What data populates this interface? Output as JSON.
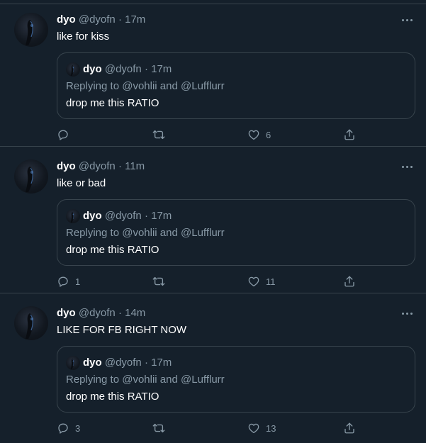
{
  "tweets": [
    {
      "name": "dyo",
      "handle": "@dyofn",
      "sep": "·",
      "time": "11m",
      "text": "like or bad",
      "quote": {
        "name": "dyo",
        "handle": "@dyofn",
        "sep": "·",
        "time": "17m",
        "replying_prefix": "Replying to ",
        "mention1": "@vohlii",
        "and": " and ",
        "mention2": "@Lufflurr",
        "text": "drop me this RATIO"
      },
      "replies": "1",
      "retweets": "",
      "likes": "11"
    },
    {
      "name": "dyo",
      "handle": "@dyofn",
      "sep": "·",
      "time": "14m",
      "text": "LIKE FOR FB RIGHT NOW",
      "quote": {
        "name": "dyo",
        "handle": "@dyofn",
        "sep": "·",
        "time": "17m",
        "replying_prefix": "Replying to ",
        "mention1": "@vohlii",
        "and": " and ",
        "mention2": "@Lufflurr",
        "text": "drop me this RATIO"
      },
      "replies": "3",
      "retweets": "",
      "likes": "13"
    },
    {
      "name": "dyo",
      "handle": "@dyofn",
      "sep": "·",
      "time": "17m",
      "text": "like for kiss",
      "quote": {
        "name": "dyo",
        "handle": "@dyofn",
        "sep": "·",
        "time": "17m",
        "replying_prefix": "Replying to ",
        "mention1": "@vohlii",
        "and": " and ",
        "mention2": "@Lufflurr",
        "text": "drop me this RATIO"
      },
      "replies": "",
      "retweets": "",
      "likes": "6"
    }
  ],
  "icons": {
    "reply": "reply-icon",
    "retweet": "retweet-icon",
    "like": "heart-icon",
    "share": "share-icon",
    "more": "more-icon"
  },
  "colors": {
    "background": "#15202b",
    "border": "#38444d",
    "secondary_text": "#8899a6",
    "primary_text": "#ffffff"
  }
}
